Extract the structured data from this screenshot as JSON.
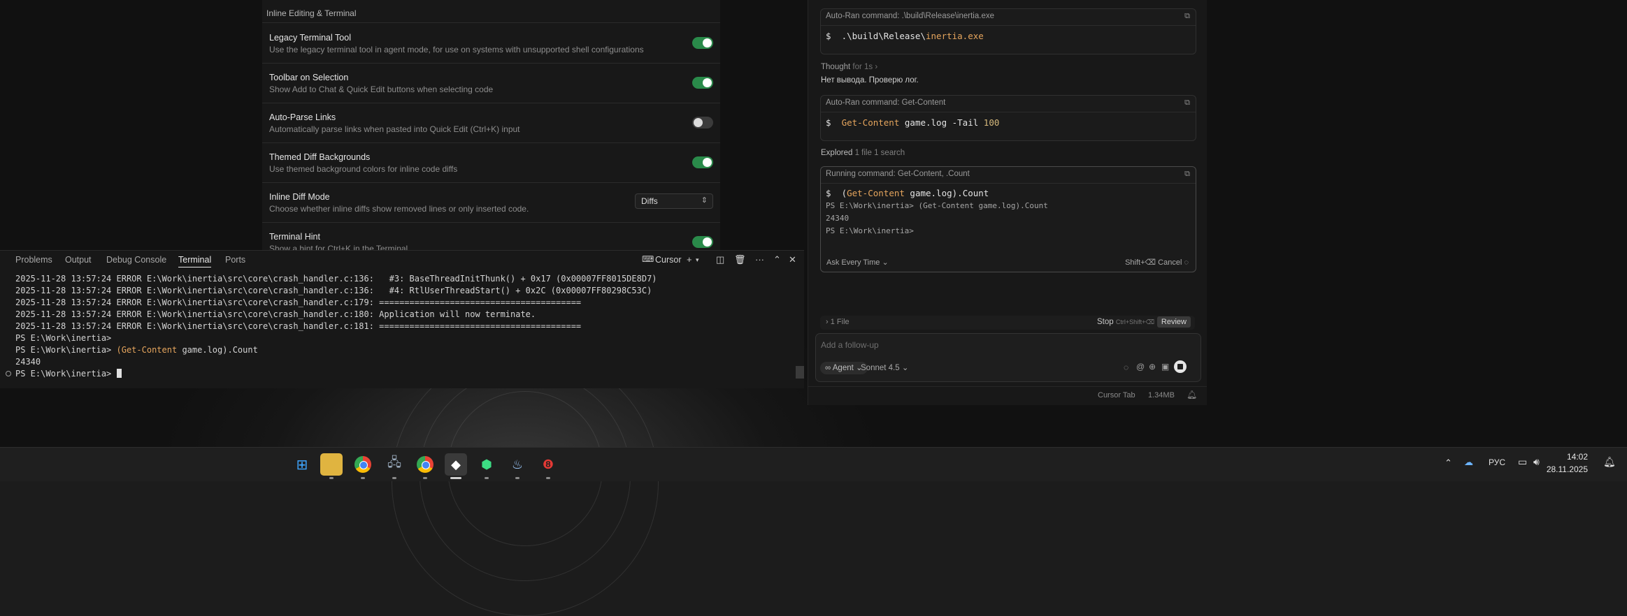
{
  "settings": {
    "section_title": "Inline Editing & Terminal",
    "rows": [
      {
        "title": "Legacy Terminal Tool",
        "desc": "Use the legacy terminal tool in agent mode, for use on systems with unsupported shell configurations",
        "on": true
      },
      {
        "title": "Toolbar on Selection",
        "desc": "Show Add to Chat & Quick Edit buttons when selecting code",
        "on": true
      },
      {
        "title": "Auto-Parse Links",
        "desc": "Automatically parse links when pasted into Quick Edit (Ctrl+K) input",
        "on": false
      },
      {
        "title": "Themed Diff Backgrounds",
        "desc": "Use themed background colors for inline code diffs",
        "on": true
      },
      {
        "title": "Inline Diff Mode",
        "desc": "Choose whether inline diffs show removed lines or only inserted code.",
        "select_value": "Diffs"
      },
      {
        "title": "Terminal Hint",
        "desc": "Show a hint for Ctrl+K in the Terminal",
        "on": true
      }
    ]
  },
  "panel": {
    "tabs": [
      "Problems",
      "Output",
      "Debug Console",
      "Terminal",
      "Ports"
    ],
    "active_tab": "Terminal",
    "shell_label": "Cursor"
  },
  "terminal": {
    "lines": [
      "2025-11-28 13:57:24 ERROR E:\\Work\\inertia\\src\\core\\crash_handler.c:136:   #3: BaseThreadInitThunk() + 0x17 (0x00007FF8015DE8D7)",
      "2025-11-28 13:57:24 ERROR E:\\Work\\inertia\\src\\core\\crash_handler.c:136:   #4: RtlUserThreadStart() + 0x2C (0x00007FF80298C53C)",
      "2025-11-28 13:57:24 ERROR E:\\Work\\inertia\\src\\core\\crash_handler.c:179: ========================================",
      "2025-11-28 13:57:24 ERROR E:\\Work\\inertia\\src\\core\\crash_handler.c:180: Application will now terminate.",
      "2025-11-28 13:57:24 ERROR E:\\Work\\inertia\\src\\core\\crash_handler.c:181: ========================================",
      "PS E:\\Work\\inertia>"
    ],
    "cmd_prompt": "PS E:\\Work\\inertia> ",
    "cmd_paren_open": "(",
    "cmd_keyword": "Get-Content",
    "cmd_rest": " game.log).Count",
    "result": "24340",
    "final_prompt": "PS E:\\Work\\inertia> "
  },
  "agent": {
    "card1": {
      "header": "Auto-Ran command: .\\build\\Release\\inertia.exe",
      "prefix": "$  .\\build\\Release\\",
      "highlight": "inertia.exe"
    },
    "thought_label": "Thought",
    "thought_time": "for 1s",
    "thought_text": "Нет вывода. Проверю лог.",
    "card2": {
      "header": "Auto-Ran command: Get-Content",
      "prefix": "$  ",
      "keyword": "Get-Content",
      "mid": " game.log -Tail ",
      "number": "100"
    },
    "explored_label": "Explored",
    "explored_detail": "1 file 1 search",
    "card3": {
      "header": "Running command: Get-Content, .Count",
      "prefix": "$  (",
      "keyword": "Get-Content",
      "rest": " game.log).Count",
      "output": [
        "PS E:\\Work\\inertia> (Get-Content game.log).Count",
        "24340",
        "PS E:\\Work\\inertia>"
      ],
      "ask_label": "Ask Every Time",
      "cancel_shortcut": "Shift+⌫",
      "cancel_label": "Cancel"
    },
    "files_label": "1 File",
    "stop_label": "Stop",
    "stop_shortcut": "Ctrl+Shift+⌫",
    "review_label": "Review",
    "followup_placeholder": "Add a follow-up",
    "mode_label": "Agent",
    "model_label": "Sonnet 4.5",
    "status": {
      "tab_label": "Cursor Tab",
      "memory": "1.34MB"
    }
  },
  "taskbar": {
    "lang": "РУС",
    "time": "14:02",
    "date": "28.11.2025"
  },
  "colors": {
    "accent_green": "#2a8a4a",
    "keyword_orange": "#e5a55d",
    "number_yellow": "#d7ba7d"
  }
}
